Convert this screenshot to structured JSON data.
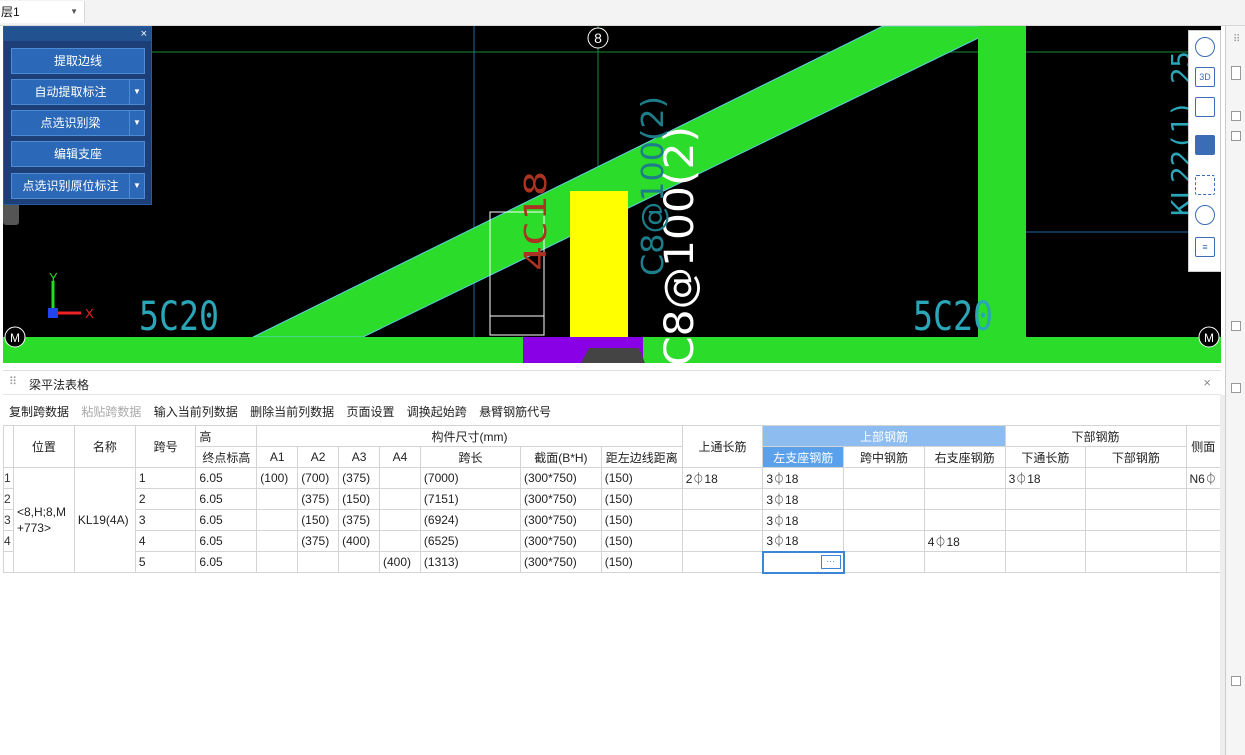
{
  "topbar": {
    "floor_value": "层1"
  },
  "panel": {
    "buttons": [
      "提取边线",
      "自动提取标注",
      "点选识别梁",
      "编辑支座",
      "点选识别原位标注"
    ]
  },
  "cad": {
    "axis_top": "8",
    "axis_left": "M",
    "axis_right": "M",
    "label_5c20_left": "5C20",
    "label_5c20_right": "5C20",
    "label_stirrup": "C8@100(2)",
    "label_faded": "C8@100(2)",
    "label_red": "4C18",
    "label_right_vertical": "KL22(1) 25",
    "coord_y": "Y",
    "coord_x": "X",
    "colors": {
      "beam": "#2bdc2b",
      "column": "#ffff00",
      "purple": "#8a00e6",
      "magenta": "#e020c0"
    }
  },
  "vtool": {
    "icons": [
      "orbit-icon",
      "3d-view-icon",
      "cube-outline-icon",
      "cube-solid-icon",
      "select-box-icon",
      "section-icon",
      "report-icon"
    ],
    "label_3d": "3D"
  },
  "table_panel": {
    "title": "梁平法表格",
    "toolbar": [
      "复制跨数据",
      "粘贴跨数据",
      "输入当前列数据",
      "删除当前列数据",
      "页面设置",
      "调换起始跨",
      "悬臂钢筋代号"
    ],
    "header": {
      "position": "位置",
      "name": "名称",
      "span": "跨号",
      "elev_top": "高",
      "size_group": "构件尺寸(mm)",
      "top_rebar_group": "上部钢筋",
      "bottom_rebar_group": "下部钢筋",
      "end_elev": "终点标高",
      "a1": "A1",
      "a2": "A2",
      "a3": "A3",
      "a4": "A4",
      "span_len": "跨长",
      "section": "截面(B*H)",
      "edge_dist": "距左边线距离",
      "top_through": "上通长筋",
      "left_support": "左支座钢筋",
      "mid": "跨中钢筋",
      "right_support": "右支座钢筋",
      "bottom_through": "下通长筋",
      "bottom_rebar": "下部钢筋",
      "side": "侧面"
    },
    "merged": {
      "position": "<8,H;8,M +773>",
      "name": "KL19(4A)"
    },
    "rows": [
      {
        "rn": "1",
        "span": "1",
        "end_elev": "6.05",
        "a1": "(100)",
        "a2": "(700)",
        "a3": "(375)",
        "a4": "",
        "span_len": "(7000)",
        "section": "(300*750)",
        "edge": "(150)",
        "top_through": "2⏀18",
        "left": "3⏀18",
        "mid": "",
        "right": "",
        "bottom_through": "3⏀18",
        "bottom": "",
        "side": "N6⏀"
      },
      {
        "rn": "2",
        "span": "2",
        "end_elev": "6.05",
        "a1": "",
        "a2": "(375)",
        "a3": "(150)",
        "a4": "",
        "span_len": "(7151)",
        "section": "(300*750)",
        "edge": "(150)",
        "top_through": "",
        "left": "3⏀18",
        "mid": "",
        "right": "",
        "bottom_through": "",
        "bottom": "",
        "side": ""
      },
      {
        "rn": "3",
        "span": "3",
        "end_elev": "6.05",
        "a1": "",
        "a2": "(150)",
        "a3": "(375)",
        "a4": "",
        "span_len": "(6924)",
        "section": "(300*750)",
        "edge": "(150)",
        "top_through": "",
        "left": "3⏀18",
        "mid": "",
        "right": "",
        "bottom_through": "",
        "bottom": "",
        "side": ""
      },
      {
        "rn": "4",
        "span": "4",
        "end_elev": "6.05",
        "a1": "",
        "a2": "(375)",
        "a3": "(400)",
        "a4": "",
        "span_len": "(6525)",
        "section": "(300*750)",
        "edge": "(150)",
        "top_through": "",
        "left": "3⏀18",
        "mid": "",
        "right": "4⏀18",
        "bottom_through": "",
        "bottom": "",
        "side": ""
      },
      {
        "rn": "5",
        "span": "5",
        "end_elev": "6.05",
        "a1": "",
        "a2": "",
        "a3": "",
        "a4": "(400)",
        "span_len": "(1313)",
        "section": "(300*750)",
        "edge": "(150)",
        "top_through": "",
        "left": "",
        "mid": "",
        "right": "",
        "bottom_through": "",
        "bottom": "",
        "side": ""
      }
    ]
  }
}
